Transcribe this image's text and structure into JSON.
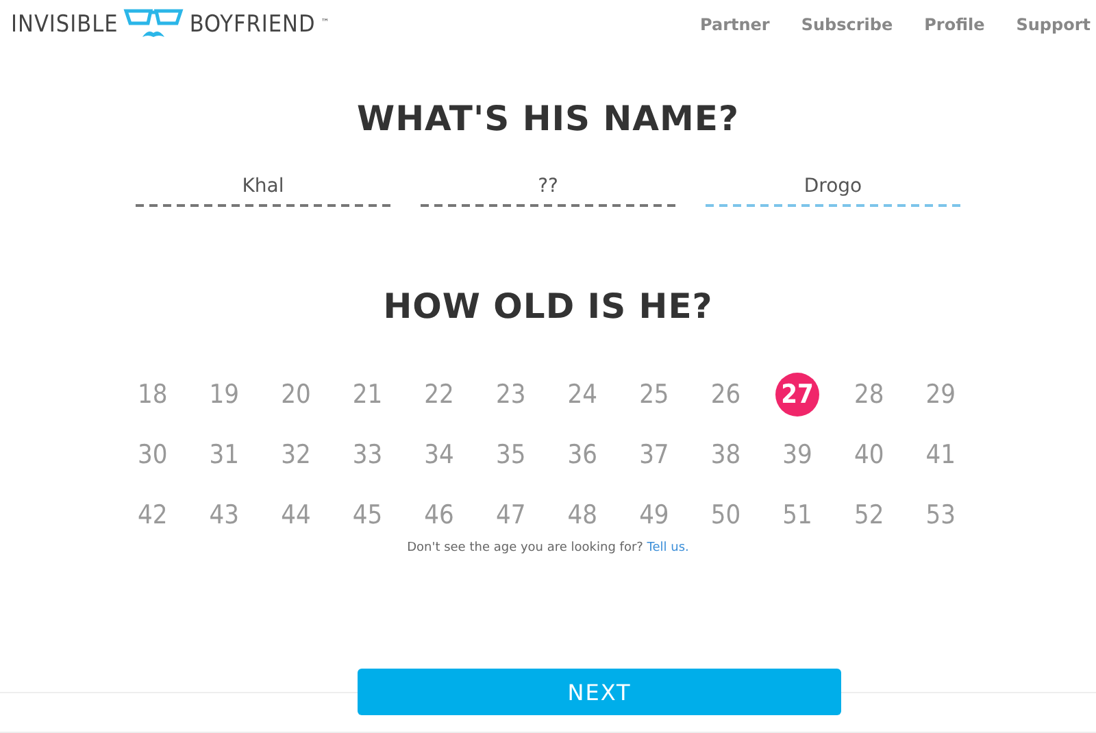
{
  "logo": {
    "left": "INVISIBLE",
    "right": "BOYFRIEND",
    "mark": "™"
  },
  "nav": [
    "Partner",
    "Subscribe",
    "Profile",
    "Support"
  ],
  "name_section": {
    "title": "WHAT'S HIS NAME?",
    "fields": [
      {
        "value": "Khal",
        "focused": false
      },
      {
        "value": "??",
        "focused": false
      },
      {
        "value": "Drogo",
        "focused": true
      }
    ]
  },
  "age_section": {
    "title": "HOW OLD IS HE?",
    "ages": [
      {
        "label": "18",
        "selected": false
      },
      {
        "label": "19",
        "selected": false
      },
      {
        "label": "20",
        "selected": false
      },
      {
        "label": "21",
        "selected": false
      },
      {
        "label": "22",
        "selected": false
      },
      {
        "label": "23",
        "selected": false
      },
      {
        "label": "24",
        "selected": false
      },
      {
        "label": "25",
        "selected": false
      },
      {
        "label": "26",
        "selected": false
      },
      {
        "label": "27",
        "selected": true
      },
      {
        "label": "28",
        "selected": false
      },
      {
        "label": "29",
        "selected": false
      },
      {
        "label": "30",
        "selected": false
      },
      {
        "label": "31",
        "selected": false
      },
      {
        "label": "32",
        "selected": false
      },
      {
        "label": "33",
        "selected": false
      },
      {
        "label": "34",
        "selected": false
      },
      {
        "label": "35",
        "selected": false
      },
      {
        "label": "36",
        "selected": false
      },
      {
        "label": "37",
        "selected": false
      },
      {
        "label": "38",
        "selected": false
      },
      {
        "label": "39",
        "selected": false
      },
      {
        "label": "40",
        "selected": false
      },
      {
        "label": "41",
        "selected": false
      },
      {
        "label": "42",
        "selected": false
      },
      {
        "label": "43",
        "selected": false
      },
      {
        "label": "44",
        "selected": false
      },
      {
        "label": "45",
        "selected": false
      },
      {
        "label": "46",
        "selected": false
      },
      {
        "label": "47",
        "selected": false
      },
      {
        "label": "48",
        "selected": false
      },
      {
        "label": "49",
        "selected": false
      },
      {
        "label": "50",
        "selected": false
      },
      {
        "label": "51",
        "selected": false
      },
      {
        "label": "52",
        "selected": false
      },
      {
        "label": "53",
        "selected": false
      }
    ],
    "hint": "Don't see the age you are looking for? ",
    "hint_link": "Tell us."
  },
  "next_button": "NEXT"
}
